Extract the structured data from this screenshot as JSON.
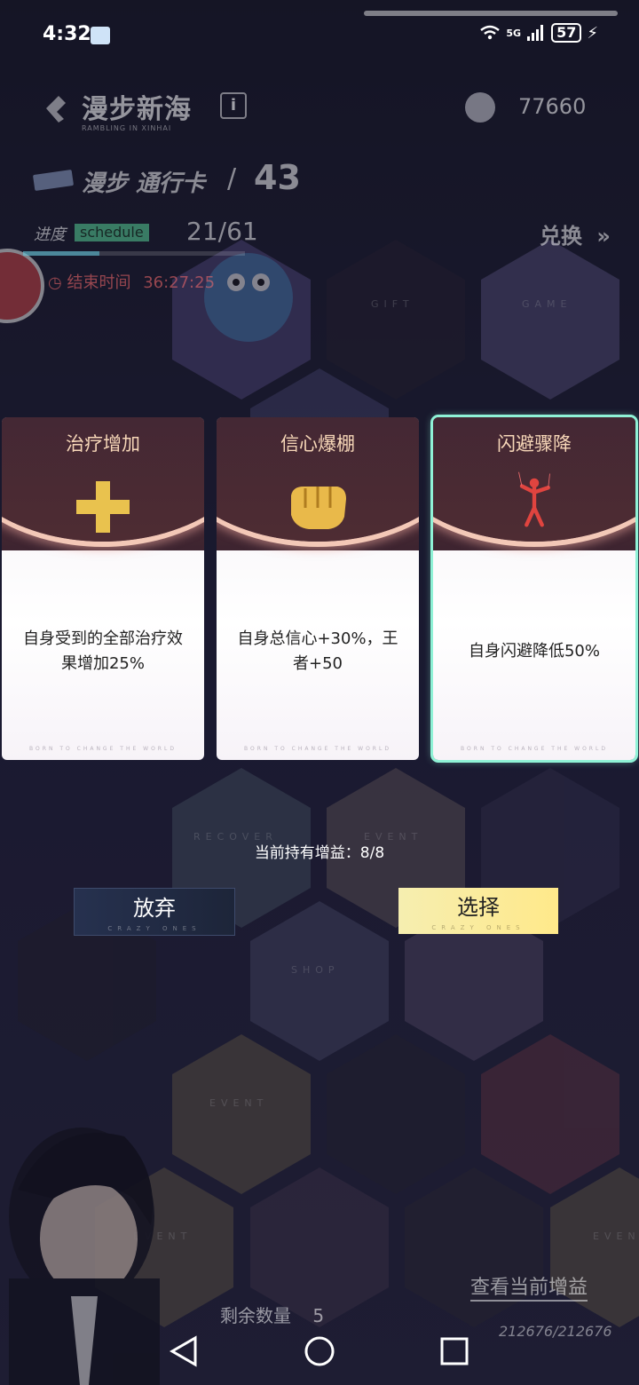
{
  "status_bar": {
    "time": "4:32",
    "network": "5G",
    "battery": "57",
    "wifi_icon": "wifi-icon",
    "signal_icon": "signal-icon"
  },
  "header": {
    "title": "漫步新海",
    "title_en": "RAMBLING IN XINHAI",
    "info_icon": "info-icon",
    "currency_icon": "coin-icon",
    "currency_value": "77660",
    "pass_label": "漫步 通行卡",
    "pass_divider": "/",
    "pass_level": "43",
    "progress_label": "进度",
    "progress_tag": "schedule",
    "progress_count": "21/61",
    "progress_fraction": 0.344,
    "end_time_label": "结束时间",
    "end_time_value": "36:27:25",
    "exchange_label": "兑换"
  },
  "board_labels": {
    "gift": "GIFT",
    "game": "GAME",
    "recover": "RECOVER",
    "event": "EVENT",
    "shop": "SHOP"
  },
  "cards": [
    {
      "title": "治疗增加",
      "icon": "heal-plus-icon",
      "description": "自身受到的全部治疗效果增加25%",
      "footer": "BORN TO CHANGE THE WORLD",
      "selected": false
    },
    {
      "title": "信心爆棚",
      "icon": "fist-icon",
      "description": "自身总信心+30%，王者+50",
      "footer": "BORN TO CHANGE THE WORLD",
      "selected": false
    },
    {
      "title": "闪避骤降",
      "icon": "puppet-icon",
      "description": "自身闪避降低50%",
      "footer": "BORN TO CHANGE THE WORLD",
      "selected": true
    }
  ],
  "current_buffs": "当前持有增益：8/8",
  "buttons": {
    "give_up": "放弃",
    "give_up_sub": "CRAZY ONES",
    "select": "选择",
    "select_sub": "CRAZY ONES"
  },
  "footer": {
    "view_buffs": "查看当前增益",
    "remaining_label": "剩余数量",
    "remaining_value": "5",
    "score": "212676/212676"
  },
  "nav_bar": {
    "back_icon": "back-triangle-icon",
    "home_icon": "home-circle-icon",
    "recents_icon": "recents-square-icon"
  }
}
